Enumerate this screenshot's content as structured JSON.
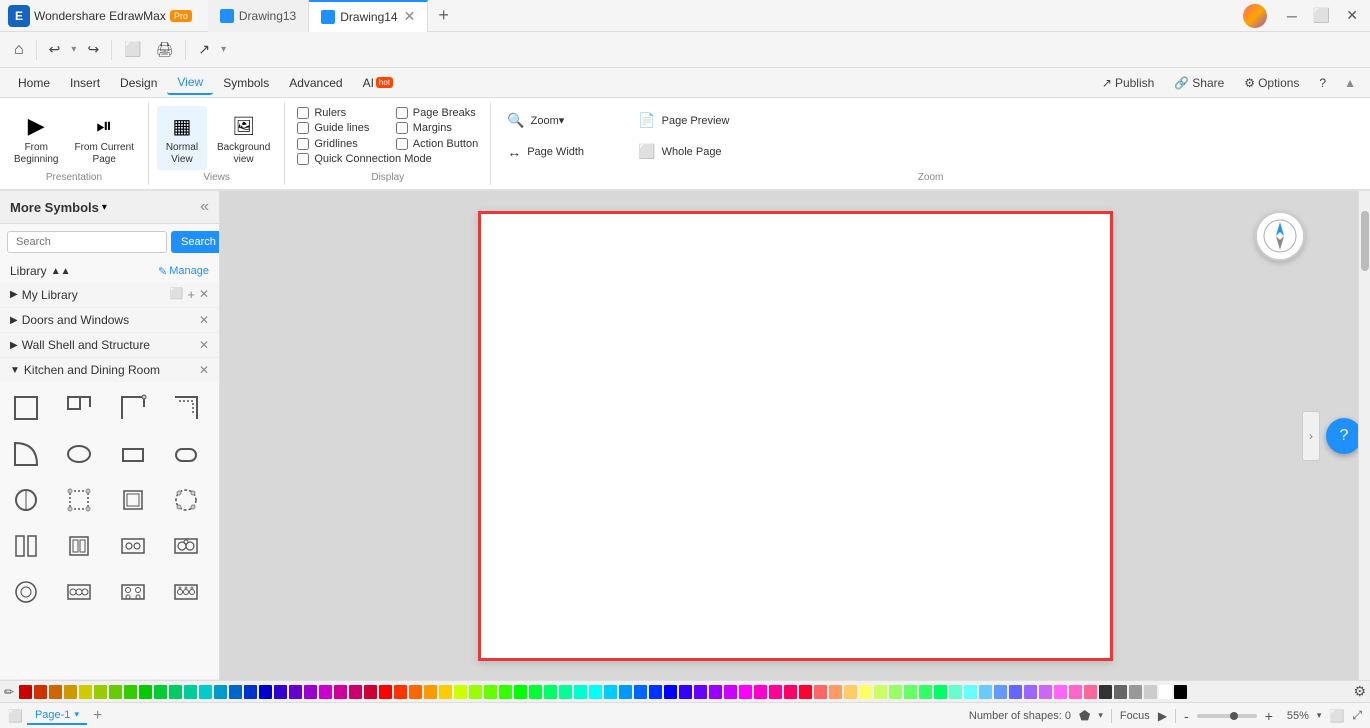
{
  "titleBar": {
    "appName": "Wondershare EdrawMax",
    "proBadge": "Pro",
    "tabs": [
      {
        "label": "Drawing13",
        "active": false
      },
      {
        "label": "Drawing14",
        "active": true
      }
    ],
    "addTabLabel": "+"
  },
  "toolbar": {
    "buttons": [
      "⌂",
      "↩",
      "↪",
      "⬜",
      "🖨",
      "💾",
      "↗",
      "▾"
    ]
  },
  "menuBar": {
    "items": [
      {
        "label": "Home",
        "active": false
      },
      {
        "label": "Insert",
        "active": false
      },
      {
        "label": "Design",
        "active": false
      },
      {
        "label": "View",
        "active": true
      },
      {
        "label": "Symbols",
        "active": false
      },
      {
        "label": "Advanced",
        "active": false
      },
      {
        "label": "AI",
        "active": false,
        "hot": true
      }
    ],
    "rightActions": [
      {
        "label": "Publish"
      },
      {
        "label": "Share"
      },
      {
        "label": "Options"
      },
      {
        "label": "?"
      }
    ]
  },
  "ribbon": {
    "groups": [
      {
        "label": "Presentation",
        "buttons": [
          {
            "icon": "▶",
            "label": "From\nBeginning"
          },
          {
            "icon": "⏯",
            "label": "From Current\nPage"
          }
        ]
      },
      {
        "label": "Views",
        "buttons": [
          {
            "icon": "▦",
            "label": "Normal\nView",
            "active": true
          },
          {
            "icon": "🖼",
            "label": "Background\nview"
          }
        ]
      },
      {
        "label": "Display",
        "checkboxes": [
          {
            "label": "Rulers",
            "checked": false
          },
          {
            "label": "Page Breaks",
            "checked": false
          },
          {
            "label": "Guide lines",
            "checked": false
          },
          {
            "label": "Margins",
            "checked": false
          },
          {
            "label": "Gridlines",
            "checked": false
          },
          {
            "label": "Action Button",
            "checked": false
          },
          {
            "label": "Quick Connection Mode",
            "checked": false
          }
        ]
      },
      {
        "label": "Zoom",
        "zoomItems": [
          {
            "icon": "🔍",
            "label": "Zoom▾"
          },
          {
            "icon": "📄",
            "label": "Page Preview"
          },
          {
            "icon": "↔",
            "label": "Page Width"
          },
          {
            "icon": "⬜",
            "label": "Whole Page"
          }
        ]
      }
    ]
  },
  "sidebar": {
    "title": "More Symbols",
    "searchPlaceholder": "Search",
    "searchButton": "Search",
    "libraryLabel": "Library",
    "manageLabel": "Manage",
    "sections": [
      {
        "label": "My Library",
        "expanded": true,
        "hasActions": true
      },
      {
        "label": "Doors and Windows",
        "expanded": false,
        "hasActions": true
      },
      {
        "label": "Wall Shell and Structure",
        "expanded": false,
        "hasActions": true
      },
      {
        "label": "Kitchen and Dining Room",
        "expanded": true,
        "hasActions": true
      }
    ]
  },
  "canvas": {
    "bgColor": "#e8e8e8",
    "pageColor": "white",
    "borderColor": "#e53935"
  },
  "bottomBar": {
    "pageTab": "Page-1",
    "shapesCount": "Number of shapes: 0",
    "focusLabel": "Focus",
    "zoomLevel": "55%"
  },
  "colors": [
    "#cc0000",
    "#cc3300",
    "#cc6600",
    "#cc9900",
    "#cccc00",
    "#99cc00",
    "#66cc00",
    "#33cc00",
    "#00cc00",
    "#00cc33",
    "#00cc66",
    "#00cc99",
    "#00cccc",
    "#0099cc",
    "#0066cc",
    "#0033cc",
    "#0000cc",
    "#3300cc",
    "#6600cc",
    "#9900cc",
    "#cc00cc",
    "#cc0099",
    "#cc0066",
    "#cc0033",
    "#ff0000",
    "#ff3300",
    "#ff6600",
    "#ff9900",
    "#ffcc00",
    "#ccff00",
    "#99ff00",
    "#66ff00",
    "#33ff00",
    "#00ff00",
    "#00ff33",
    "#00ff66",
    "#00ff99",
    "#00ffcc",
    "#00ffff",
    "#00ccff",
    "#0099ff",
    "#0066ff",
    "#0033ff",
    "#0000ff",
    "#3300ff",
    "#6600ff",
    "#9900ff",
    "#cc00ff",
    "#ff00ff",
    "#ff00cc",
    "#ff0099",
    "#ff0066",
    "#ff0033",
    "#ff6666",
    "#ff9966",
    "#ffcc66",
    "#ffff66",
    "#ccff66",
    "#99ff66",
    "#66ff66",
    "#33ff66",
    "#00ff66",
    "#66ffcc",
    "#66ffff",
    "#66ccff",
    "#6699ff",
    "#6666ff",
    "#9966ff",
    "#cc66ff",
    "#ff66ff",
    "#ff66cc",
    "#ff6699",
    "#333333",
    "#666666",
    "#999999",
    "#cccccc",
    "#ffffff",
    "#000000"
  ]
}
